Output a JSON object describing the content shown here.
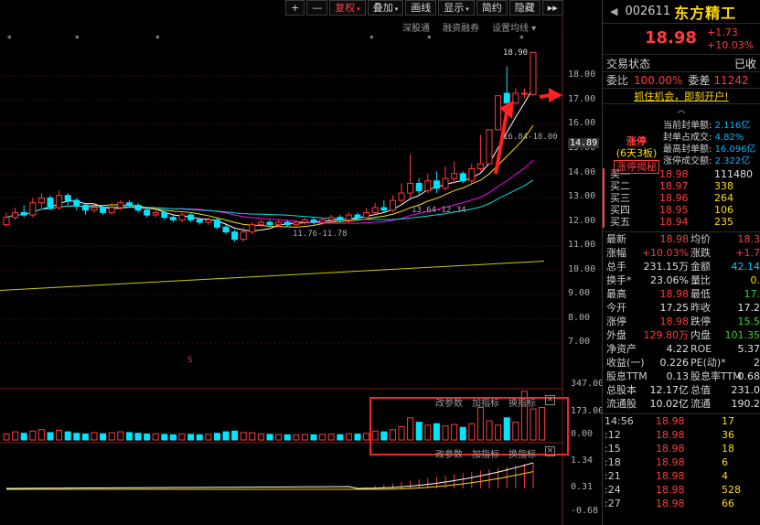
{
  "toolbar": {
    "items": [
      {
        "label": "+",
        "active": false,
        "dropdown": false
      },
      {
        "label": "—",
        "active": false,
        "dropdown": false
      },
      {
        "label": "复权",
        "active": true,
        "dropdown": true
      },
      {
        "label": "叠加",
        "active": false,
        "dropdown": true
      },
      {
        "label": "画线",
        "active": false,
        "dropdown": false
      },
      {
        "label": "显示",
        "active": false,
        "dropdown": true
      },
      {
        "label": "简约",
        "active": false,
        "dropdown": false
      },
      {
        "label": "隐藏",
        "active": false,
        "dropdown": false
      },
      {
        "label": "▸▸",
        "active": false,
        "dropdown": false
      }
    ],
    "sub": [
      "深股通",
      "融资融券",
      "设置均线 ▾"
    ]
  },
  "chart": {
    "price_axis": [
      "18.00",
      "17.00",
      "16.00",
      "15.00",
      "14.89",
      "14.00",
      "13.00",
      "12.00",
      "11.00",
      "10.00",
      "9.00",
      "8.00",
      "7.00"
    ],
    "vol_axis": [
      "347.00",
      "173.00",
      "0.00"
    ],
    "macd_axis": [
      "1.34",
      "0.31",
      "-0.68"
    ],
    "annotations": {
      "high": "18.90",
      "mid": "16.84-18.00",
      "low": "11.76-11.78",
      "low2": "13.64-12.34",
      "s_mark": "S"
    },
    "volume_panel": {
      "labels": [
        "改参数",
        "加指标",
        "换指标"
      ],
      "close": "×"
    },
    "macd_panel": {
      "labels": [
        "改参数",
        "加指标",
        "换指标"
      ],
      "close": "×"
    },
    "colors": {
      "up": "#ff3b3b",
      "down": "#00e5ff",
      "ma5": "#ffffff",
      "ma10": "#ffdd00",
      "ma20": "#ff00ff",
      "ma60": "#00ff00",
      "ma250": "#cccc00"
    },
    "candles": [
      {
        "o": 11.9,
        "c": 12.2,
        "h": 12.4,
        "l": 11.8
      },
      {
        "o": 12.2,
        "c": 12.4,
        "h": 12.6,
        "l": 12.1
      },
      {
        "o": 12.4,
        "c": 12.3,
        "h": 12.7,
        "l": 12.2
      },
      {
        "o": 12.3,
        "c": 12.8,
        "h": 13.0,
        "l": 12.2
      },
      {
        "o": 12.8,
        "c": 13.0,
        "h": 13.2,
        "l": 12.6
      },
      {
        "o": 13.0,
        "c": 12.6,
        "h": 13.1,
        "l": 12.5
      },
      {
        "o": 12.6,
        "c": 13.1,
        "h": 13.3,
        "l": 12.5
      },
      {
        "o": 13.1,
        "c": 12.9,
        "h": 13.2,
        "l": 12.7
      },
      {
        "o": 12.9,
        "c": 12.7,
        "h": 13.0,
        "l": 12.5
      },
      {
        "o": 12.7,
        "c": 12.5,
        "h": 12.8,
        "l": 12.3
      },
      {
        "o": 12.5,
        "c": 12.6,
        "h": 12.8,
        "l": 12.4
      },
      {
        "o": 12.6,
        "c": 12.4,
        "h": 12.7,
        "l": 12.3
      },
      {
        "o": 12.4,
        "c": 12.6,
        "h": 12.8,
        "l": 12.3
      },
      {
        "o": 12.6,
        "c": 12.8,
        "h": 12.9,
        "l": 12.5
      },
      {
        "o": 12.8,
        "c": 12.7,
        "h": 12.9,
        "l": 12.6
      },
      {
        "o": 12.7,
        "c": 12.5,
        "h": 12.8,
        "l": 12.4
      },
      {
        "o": 12.5,
        "c": 12.3,
        "h": 12.6,
        "l": 12.2
      },
      {
        "o": 12.3,
        "c": 12.4,
        "h": 12.5,
        "l": 12.2
      },
      {
        "o": 12.4,
        "c": 12.2,
        "h": 12.5,
        "l": 12.1
      },
      {
        "o": 12.2,
        "c": 12.1,
        "h": 12.3,
        "l": 12.0
      },
      {
        "o": 12.1,
        "c": 12.3,
        "h": 12.4,
        "l": 12.0
      },
      {
        "o": 12.3,
        "c": 12.1,
        "h": 12.4,
        "l": 12.0
      },
      {
        "o": 12.1,
        "c": 12.0,
        "h": 12.2,
        "l": 11.9
      },
      {
        "o": 12.0,
        "c": 12.1,
        "h": 12.2,
        "l": 11.9
      },
      {
        "o": 12.1,
        "c": 11.8,
        "h": 12.2,
        "l": 11.7
      },
      {
        "o": 11.8,
        "c": 11.6,
        "h": 11.9,
        "l": 11.5
      },
      {
        "o": 11.6,
        "c": 11.3,
        "h": 11.7,
        "l": 11.2
      },
      {
        "o": 11.3,
        "c": 11.6,
        "h": 11.8,
        "l": 11.2
      },
      {
        "o": 11.6,
        "c": 11.9,
        "h": 12.0,
        "l": 11.5
      },
      {
        "o": 11.9,
        "c": 12.0,
        "h": 12.1,
        "l": 11.8
      },
      {
        "o": 12.0,
        "c": 11.9,
        "h": 12.1,
        "l": 11.8
      },
      {
        "o": 11.9,
        "c": 12.0,
        "h": 12.1,
        "l": 11.8
      },
      {
        "o": 12.0,
        "c": 11.9,
        "h": 12.1,
        "l": 11.8
      },
      {
        "o": 11.9,
        "c": 12.0,
        "h": 12.1,
        "l": 11.8
      },
      {
        "o": 12.0,
        "c": 12.1,
        "h": 12.2,
        "l": 11.9
      },
      {
        "o": 12.1,
        "c": 12.0,
        "h": 12.2,
        "l": 11.9
      },
      {
        "o": 12.0,
        "c": 12.1,
        "h": 12.2,
        "l": 11.9
      },
      {
        "o": 12.1,
        "c": 12.2,
        "h": 12.3,
        "l": 12.0
      },
      {
        "o": 12.2,
        "c": 12.1,
        "h": 12.3,
        "l": 12.0
      },
      {
        "o": 12.1,
        "c": 12.3,
        "h": 12.4,
        "l": 12.0
      },
      {
        "o": 12.3,
        "c": 12.2,
        "h": 12.4,
        "l": 12.1
      },
      {
        "o": 12.2,
        "c": 12.4,
        "h": 12.6,
        "l": 12.1
      },
      {
        "o": 12.4,
        "c": 12.6,
        "h": 12.8,
        "l": 12.3
      },
      {
        "o": 12.6,
        "c": 12.5,
        "h": 12.9,
        "l": 12.4
      },
      {
        "o": 12.5,
        "c": 12.9,
        "h": 13.1,
        "l": 12.4
      },
      {
        "o": 12.9,
        "c": 13.2,
        "h": 13.6,
        "l": 12.8
      },
      {
        "o": 13.2,
        "c": 13.6,
        "h": 14.8,
        "l": 13.0
      },
      {
        "o": 13.6,
        "c": 13.3,
        "h": 13.8,
        "l": 13.1
      },
      {
        "o": 13.3,
        "c": 13.7,
        "h": 14.0,
        "l": 13.2
      },
      {
        "o": 13.7,
        "c": 13.4,
        "h": 14.1,
        "l": 13.2
      },
      {
        "o": 13.4,
        "c": 13.8,
        "h": 14.3,
        "l": 13.3
      },
      {
        "o": 13.8,
        "c": 14.0,
        "h": 14.5,
        "l": 13.6
      },
      {
        "o": 14.0,
        "c": 13.7,
        "h": 14.1,
        "l": 13.6
      },
      {
        "o": 13.7,
        "c": 14.2,
        "h": 14.4,
        "l": 13.6
      },
      {
        "o": 14.2,
        "c": 14.4,
        "h": 15.6,
        "l": 14.1
      },
      {
        "o": 14.4,
        "c": 15.8,
        "h": 15.8,
        "l": 14.4
      },
      {
        "o": 15.8,
        "c": 17.2,
        "h": 17.2,
        "l": 15.8
      },
      {
        "o": 17.3,
        "c": 16.9,
        "h": 18.4,
        "l": 16.8
      },
      {
        "o": 16.9,
        "c": 17.3,
        "h": 17.5,
        "l": 16.8
      },
      {
        "o": 17.3,
        "c": 17.3,
        "h": 17.5,
        "l": 17.1
      },
      {
        "o": 17.25,
        "c": 18.98,
        "h": 18.98,
        "l": 17.2
      }
    ],
    "volumes": [
      40,
      55,
      45,
      60,
      70,
      50,
      65,
      55,
      45,
      40,
      50,
      42,
      48,
      55,
      50,
      45,
      40,
      42,
      38,
      35,
      40,
      38,
      35,
      38,
      45,
      55,
      60,
      50,
      48,
      40,
      38,
      36,
      35,
      34,
      36,
      35,
      38,
      40,
      36,
      42,
      40,
      45,
      60,
      55,
      70,
      90,
      150,
      120,
      100,
      110,
      95,
      105,
      85,
      110,
      220,
      130,
      100,
      150,
      120,
      330,
      210,
      220
    ]
  },
  "quote": {
    "code": "002611",
    "name": "东方精工",
    "price": "18.98",
    "change": "+1.73",
    "change_pct": "+10.03%",
    "status_label": "交易状态",
    "status_value": "已收",
    "ratio_label": "委比",
    "ratio_value": "100.00%",
    "diff_label": "委差",
    "diff_value": "11242",
    "ad": "抓住机会，即刻开户!",
    "limit": {
      "tag1": "涨停",
      "tag2": "(6天3板)",
      "tag3": "涨停揭秘",
      "rows": [
        {
          "l": "当前封单额:",
          "v": "2.116亿"
        },
        {
          "l": "封单占成交:",
          "v": "4.82%"
        },
        {
          "l": "最高封单额:",
          "v": "16.096亿"
        },
        {
          "l": "涨停成交额:",
          "v": "2.322亿"
        }
      ]
    },
    "bids": [
      {
        "l": "买一",
        "p": "18.98",
        "v": "111480"
      },
      {
        "l": "买二",
        "p": "18.97",
        "v": "338"
      },
      {
        "l": "买三",
        "p": "18.96",
        "v": "264"
      },
      {
        "l": "买四",
        "p": "18.95",
        "v": "106"
      },
      {
        "l": "买五",
        "p": "18.94",
        "v": "235"
      }
    ],
    "stats": [
      {
        "l": "最新",
        "v": "18.98",
        "vc": "red",
        "l2": "均价",
        "v2": "18.3",
        "v2c": "red"
      },
      {
        "l": "涨幅",
        "v": "+10.03%",
        "vc": "red",
        "l2": "涨跌",
        "v2": "+1.7",
        "v2c": "red"
      },
      {
        "l": "总手",
        "v": "231.15万",
        "vc": "wht",
        "l2": "金额",
        "v2": "42.14",
        "v2c": "cyn"
      },
      {
        "l": "换手*",
        "v": "23.06%",
        "vc": "wht",
        "l2": "量比",
        "v2": "0.",
        "v2c": "ylw"
      },
      {
        "l": "最高",
        "v": "18.98",
        "vc": "red",
        "l2": "最低",
        "v2": "17.",
        "v2c": "grn"
      },
      {
        "l": "今开",
        "v": "17.25",
        "vc": "wht",
        "l2": "昨收",
        "v2": "17.2",
        "v2c": "wht"
      },
      {
        "l": "涨停",
        "v": "18.98",
        "vc": "red",
        "l2": "跌停",
        "v2": "15.5",
        "v2c": "grn"
      },
      {
        "l": "外盘",
        "v": "129.80万",
        "vc": "red",
        "l2": "内盘",
        "v2": "101.35",
        "v2c": "grn"
      },
      {
        "l": "净资产",
        "v": "4.22",
        "vc": "wht",
        "l2": "ROE",
        "v2": "5.37",
        "v2c": "wht"
      },
      {
        "l": "收益(一)",
        "v": "0.226",
        "vc": "wht",
        "l2": "PE(动)*",
        "v2": "2",
        "v2c": "wht"
      },
      {
        "l": "股息TTM",
        "v": "0.13",
        "vc": "wht",
        "l2": "股息率TTM",
        "v2": "0.68",
        "v2c": "wht"
      },
      {
        "l": "总股本",
        "v": "12.17亿",
        "vc": "wht",
        "l2": "总值",
        "v2": "231.0",
        "v2c": "wht"
      },
      {
        "l": "流通股",
        "v": "10.02亿",
        "vc": "wht",
        "l2": "流通",
        "v2": "190.2",
        "v2c": "wht"
      }
    ],
    "ticks": [
      {
        "t": "14:56",
        "p": "18.98",
        "v": "17"
      },
      {
        "t": ":12",
        "p": "18.98",
        "v": "36"
      },
      {
        "t": ":15",
        "p": "18.98",
        "v": "18"
      },
      {
        "t": ":18",
        "p": "18.98",
        "v": "6"
      },
      {
        "t": ":21",
        "p": "18.98",
        "v": "4"
      },
      {
        "t": ":24",
        "p": "18.98",
        "v": "528"
      },
      {
        "t": ":27",
        "p": "18.98",
        "v": "66"
      }
    ]
  }
}
